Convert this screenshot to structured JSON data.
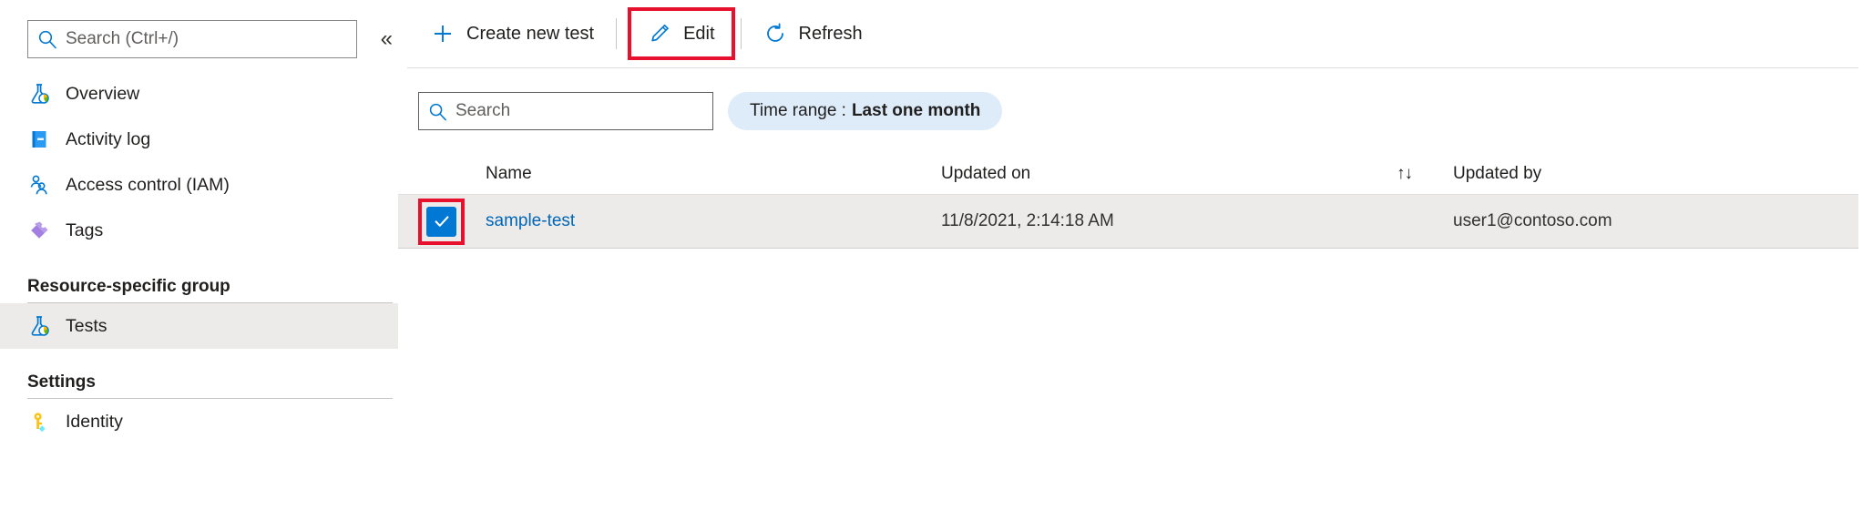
{
  "sidebar": {
    "search": {
      "placeholder": "Search (Ctrl+/)",
      "value": "",
      "icon": "search-icon"
    },
    "collapse_icon": "«",
    "items": [
      {
        "label": "Overview",
        "icon": "flask-chart-icon",
        "selected": false
      },
      {
        "label": "Activity log",
        "icon": "activity-log-icon",
        "selected": false
      },
      {
        "label": "Access control (IAM)",
        "icon": "access-control-icon",
        "selected": false
      },
      {
        "label": "Tags",
        "icon": "tag-icon",
        "selected": false
      }
    ],
    "sections": [
      {
        "title": "Resource-specific group",
        "items": [
          {
            "label": "Tests",
            "icon": "flask-chart-icon",
            "selected": true
          }
        ]
      },
      {
        "title": "Settings",
        "items": [
          {
            "label": "Identity",
            "icon": "key-icon",
            "selected": false
          }
        ]
      }
    ]
  },
  "toolbar": {
    "create_label": "Create new test",
    "create_icon": "plus-icon",
    "edit_label": "Edit",
    "edit_icon": "pencil-icon",
    "refresh_label": "Refresh",
    "refresh_icon": "refresh-icon"
  },
  "filters": {
    "search": {
      "placeholder": "Search",
      "value": "",
      "icon": "search-icon"
    },
    "time_range": {
      "label": "Time range :",
      "value": "Last one month"
    }
  },
  "table": {
    "headers": {
      "name": "Name",
      "updated_on": "Updated on",
      "updated_by": "Updated by",
      "sort_icon": "↑↓"
    },
    "rows": [
      {
        "checked": true,
        "name": "sample-test",
        "updated_on": "11/8/2021, 2:14:18 AM",
        "updated_by": "user1@contoso.com"
      }
    ]
  },
  "colors": {
    "accent": "#0078d4",
    "link": "#0067b8",
    "highlight_red": "#e8112d",
    "row_selected_bg": "#edebe9",
    "pill_bg": "#deecf9"
  }
}
